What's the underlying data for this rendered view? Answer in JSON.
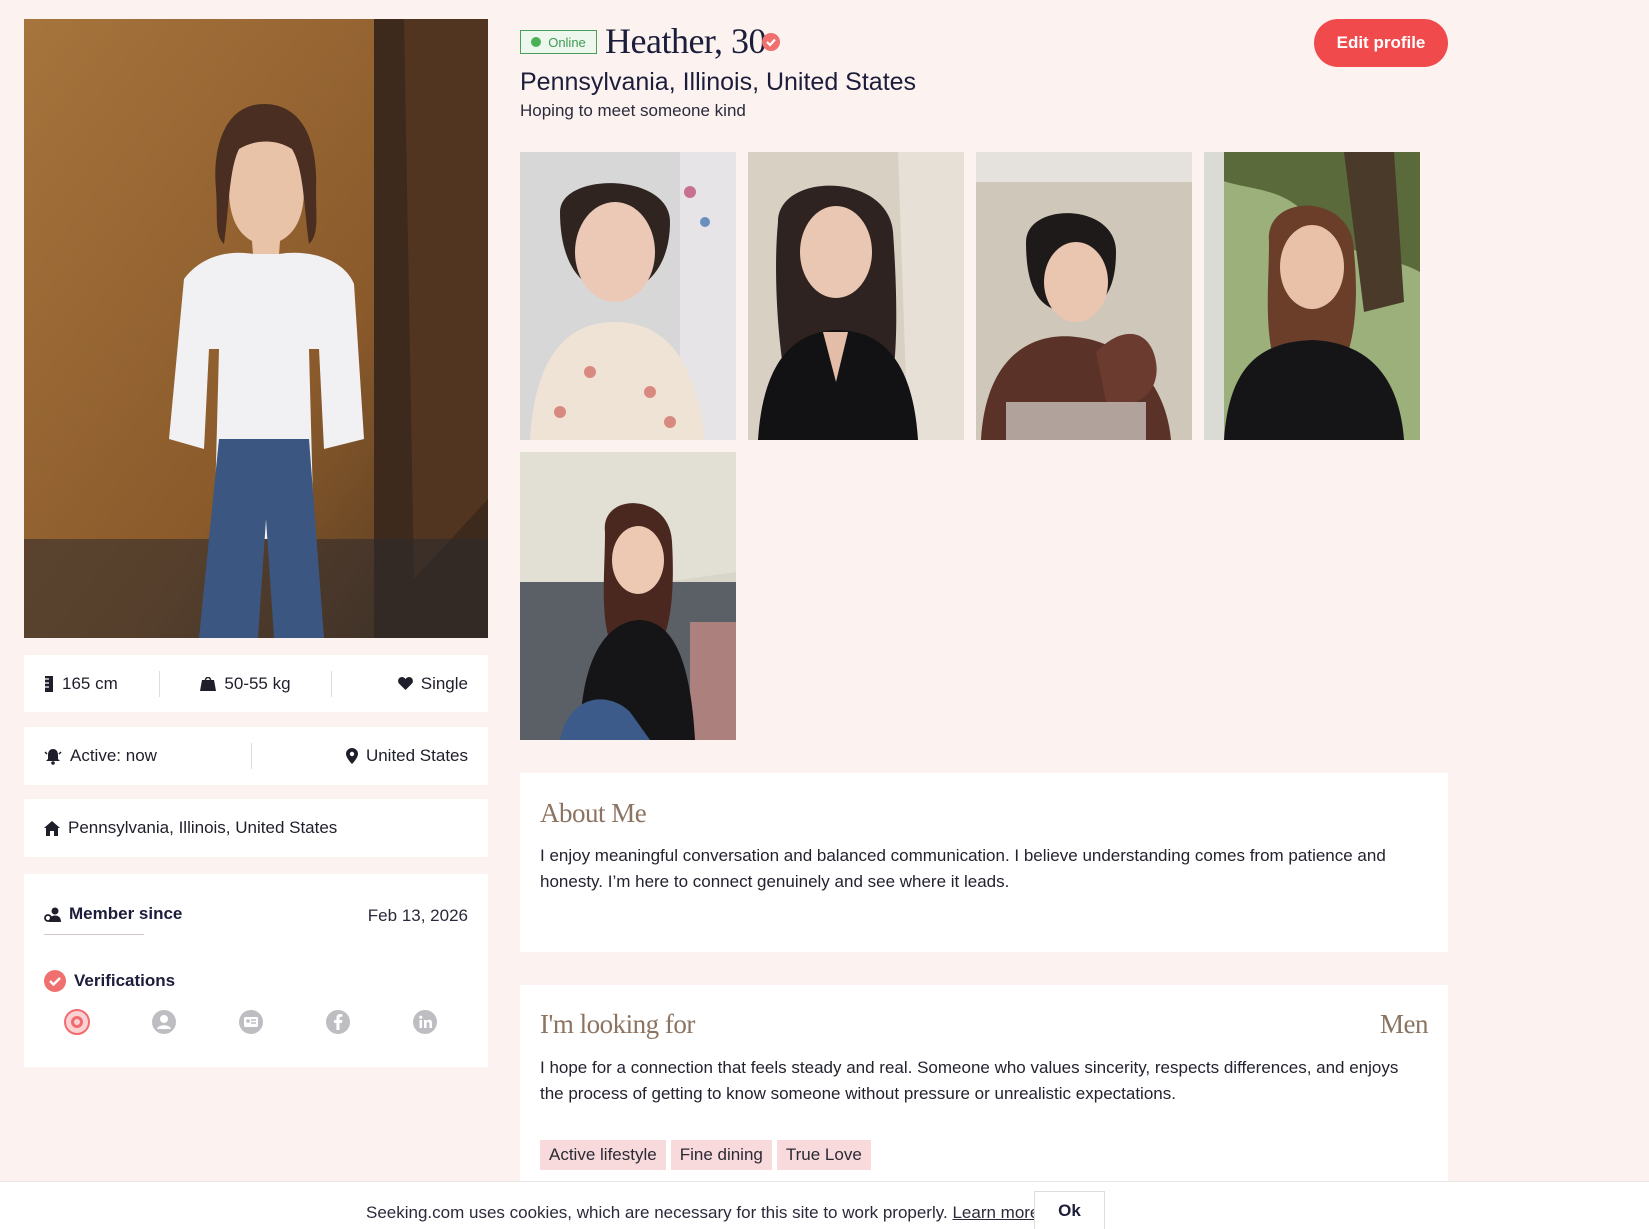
{
  "profile": {
    "online_label": "Online",
    "name_age": "Heather, 30",
    "location": "Pennsylvania, Illinois, United States",
    "tagline": "Hoping to meet someone kind",
    "edit_label": "Edit profile"
  },
  "stats": {
    "height": "165 cm",
    "weight": "50-55 kg",
    "relationship": "Single",
    "active": "Active: now",
    "country": "United States",
    "hometown": "Pennsylvania, Illinois, United States"
  },
  "member": {
    "since_label": "Member since",
    "since_date": "Feb 13, 2026",
    "verifications_label": "Verifications",
    "verification_icons": [
      "photo-verified-icon",
      "profile-verified-icon",
      "id-verified-icon",
      "facebook-icon",
      "linkedin-icon"
    ]
  },
  "about": {
    "title": "About Me",
    "text": "I enjoy meaningful conversation and balanced communication. I believe understanding comes from patience and honesty. I’m here to connect genuinely and see where it leads."
  },
  "looking_for": {
    "title": "I'm looking for",
    "gender": "Men",
    "text": "I hope for a connection that feels steady and real. Someone who values sincerity, respects differences, and enjoys the process of getting to know someone without pressure or unrealistic expectations.",
    "tags": [
      "Active lifestyle",
      "Fine dining",
      "True Love"
    ]
  },
  "cookie": {
    "text": "Seeking.com uses cookies, which are necessary for this site to work properly.",
    "link": "Learn more",
    "ok": "Ok"
  },
  "colors": {
    "background": "#fcf3f1",
    "accent": "#f04a4d",
    "online": "#4ab058",
    "section_title": "#8c7462",
    "tag_bg": "#f8d9dc"
  }
}
